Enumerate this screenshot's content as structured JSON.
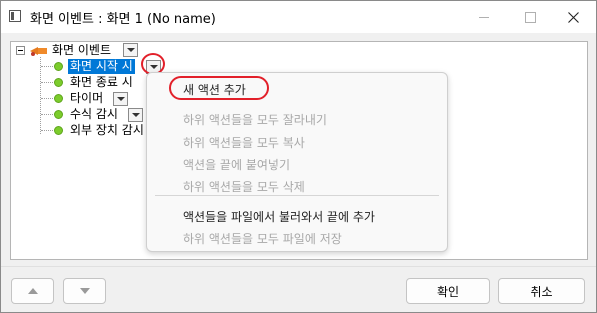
{
  "window": {
    "title": "화면 이벤트 : 화면 1 (No name)"
  },
  "tree": {
    "root_label": "화면 이벤트",
    "children": [
      {
        "label": "화면 시작 시",
        "selected": true
      },
      {
        "label": "화면 종료 시"
      },
      {
        "label": "타이머"
      },
      {
        "label": "수식 감시"
      },
      {
        "label": "외부 장치 감시"
      }
    ]
  },
  "context_menu": {
    "items": [
      {
        "label": "새 액션 추가",
        "enabled": true
      },
      {
        "label": "하위 액션들을 모두 잘라내기",
        "enabled": false
      },
      {
        "label": "하위 액션들을 모두 복사",
        "enabled": false
      },
      {
        "label": "액션을 끝에 붙여넣기",
        "enabled": false
      },
      {
        "label": "하위 액션들을 모두 삭제",
        "enabled": false
      },
      {
        "label": "액션들을 파일에서 불러와서 끝에 추가",
        "enabled": true
      },
      {
        "label": "하위 액션들을 모두 파일에 저장",
        "enabled": false
      }
    ]
  },
  "buttons": {
    "ok": "확인",
    "cancel": "취소"
  },
  "colors": {
    "selection": "#0078d7",
    "highlight_ring": "#e2202a",
    "node_dot": "#7ccc2c"
  },
  "icons": [
    "app-icon",
    "minimize-icon",
    "maximize-icon",
    "close-icon",
    "expander-minus-icon",
    "event-root-icon",
    "dropdown-arrow-icon",
    "node-dot-icon",
    "arrow-up-icon",
    "arrow-down-icon"
  ]
}
